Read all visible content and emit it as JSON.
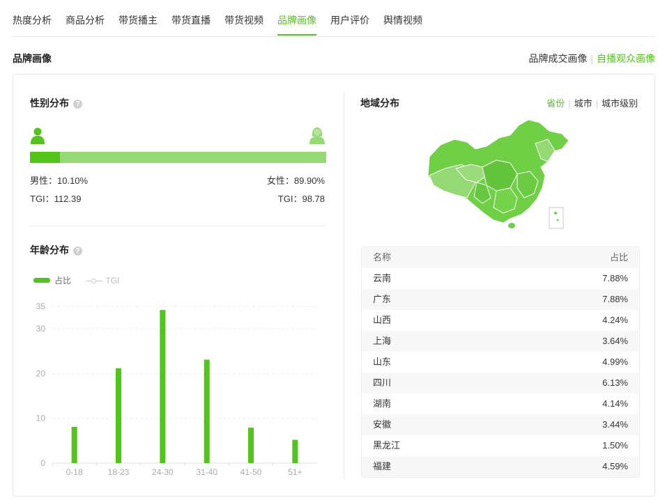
{
  "tabs": [
    {
      "label": "热度分析"
    },
    {
      "label": "商品分析"
    },
    {
      "label": "带货播主"
    },
    {
      "label": "带货直播"
    },
    {
      "label": "带货视频"
    },
    {
      "label": "品牌画像"
    },
    {
      "label": "用户评价"
    },
    {
      "label": "舆情视频"
    }
  ],
  "active_tab": "品牌画像",
  "page_title": "品牌画像",
  "view_switch": {
    "option1": "品牌成交画像",
    "option2": "自播观众画像",
    "active": "自播观众画像"
  },
  "gender": {
    "title": "性别分布",
    "male_label": "男性：10.10%",
    "female_label": "女性：89.90%",
    "male_tgi": "TGI：112.39",
    "female_tgi": "TGI：98.78",
    "male_fraction": 0.101,
    "colors": {
      "male": "#52c41a",
      "female": "#95d975"
    }
  },
  "age": {
    "title": "年龄分布",
    "legend_share": "占比",
    "legend_tgi": "TGI",
    "chart_data": {
      "type": "bar",
      "categories": [
        "0-18",
        "18-23",
        "24-30",
        "31-40",
        "41-50",
        "51+"
      ],
      "series": [
        {
          "name": "占比",
          "values": [
            8.1,
            21.2,
            34.2,
            23.1,
            7.9,
            5.2
          ]
        }
      ],
      "y_ticks": [
        0,
        10,
        20,
        30,
        35
      ],
      "ylim": [
        0,
        35
      ],
      "grid": true,
      "legend_position": "top-left",
      "color": "#52c41a"
    }
  },
  "region": {
    "title": "地域分布",
    "tabs": [
      {
        "label": "省份"
      },
      {
        "label": "城市"
      },
      {
        "label": "城市级别"
      }
    ],
    "active": "省份",
    "table_header": {
      "name": "名称",
      "share": "占比"
    },
    "rows": [
      {
        "name": "云南",
        "share": "7.88%"
      },
      {
        "name": "广东",
        "share": "7.88%"
      },
      {
        "name": "山西",
        "share": "4.24%"
      },
      {
        "name": "上海",
        "share": "3.64%"
      },
      {
        "name": "山东",
        "share": "4.99%"
      },
      {
        "name": "四川",
        "share": "6.13%"
      },
      {
        "name": "湖南",
        "share": "4.14%"
      },
      {
        "name": "安徽",
        "share": "3.44%"
      },
      {
        "name": "黑龙江",
        "share": "1.50%"
      },
      {
        "name": "福建",
        "share": "4.59%"
      }
    ]
  },
  "icons": {
    "male": "user-male-icon",
    "female": "user-female-icon",
    "help": "help-icon",
    "map": "china-map-icon"
  }
}
